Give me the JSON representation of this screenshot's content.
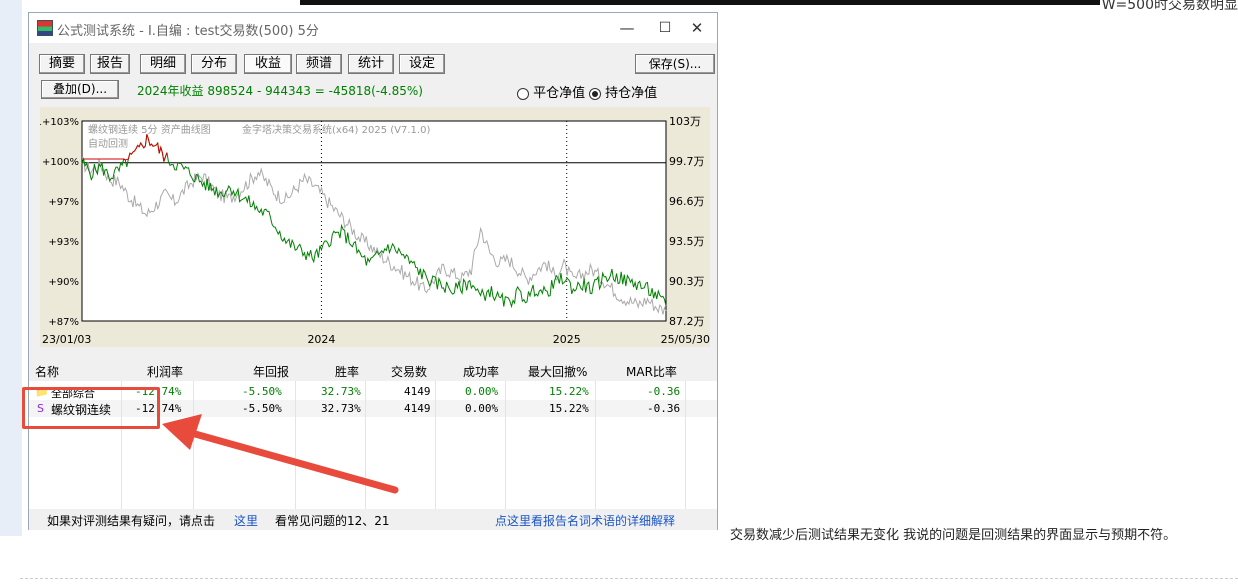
{
  "window": {
    "title": "公式测试系统 - I.自编 : test交易数(500) 5分",
    "min_symbol": "—",
    "max_symbol": "☐",
    "close_symbol": "✕"
  },
  "tabs": [
    {
      "label": "摘要"
    },
    {
      "label": "报告"
    },
    {
      "label": "明细"
    },
    {
      "label": "分布"
    },
    {
      "label": "收益"
    },
    {
      "label": "频谱"
    },
    {
      "label": "统计"
    },
    {
      "label": "设定"
    }
  ],
  "toolbar": {
    "save_label": "保存(S)...",
    "overlay_label": "叠加(D)...",
    "yearly_income": "2024年收益  898524 - 944343 = -45818(-4.85%)",
    "radio_flat": "平仓净值",
    "radio_hold": "持仓净值",
    "selected_radio": "持仓净值"
  },
  "chart_data": {
    "type": "line",
    "overlay_title_1": "螺纹钢连续 5分  资产曲线图",
    "overlay_title_2": "金字塔决策交易系统(x64) 2025 (V7.1.0)",
    "overlay_label_3": "自动回测",
    "left_ticks": [
      "1+103%",
      "+100%",
      "+97%",
      "+93%",
      "+90%",
      "+87%"
    ],
    "right_ticks": [
      "103万",
      "99.7万",
      "96.6万",
      "93.5万",
      "90.3万",
      "87.2万"
    ],
    "x_ticks": [
      "23/01/03",
      "2024",
      "2025",
      "25/05/30"
    ],
    "ylim": [
      87.2,
      103
    ],
    "baseline": 99.7,
    "series": [
      {
        "color": "#008000",
        "values": [
          99.7,
          98.9,
          99.4,
          98.6,
          99.1,
          99.9,
          100.6,
          101.6,
          101.0,
          100.1,
          99.6,
          99.2,
          98.7,
          98.1,
          97.7,
          97.3,
          97.8,
          97.1,
          96.6,
          96.0,
          95.6,
          94.6,
          93.5,
          93.0,
          92.6,
          92.2,
          92.9,
          93.9,
          94.2,
          93.5,
          92.4,
          91.7,
          92.4,
          93.1,
          92.8,
          92.1,
          91.4,
          90.7,
          90.2,
          90.0,
          89.6,
          89.9,
          90.3,
          89.1,
          89.6,
          88.9,
          88.6,
          89.4,
          89.0,
          89.8,
          89.3,
          90.2,
          90.6,
          89.7,
          90.1,
          89.7,
          90.4,
          90.9,
          90.6,
          90.3,
          90.1,
          89.7,
          89.2,
          88.4
        ]
      },
      {
        "color": "#aaaaaa",
        "values": [
          99.7,
          99.1,
          99.6,
          98.4,
          98.2,
          97.1,
          96.3,
          95.6,
          96.4,
          97.2,
          96.6,
          97.5,
          98.3,
          98.7,
          97.8,
          97.1,
          96.9,
          97.5,
          98.2,
          99.0,
          98.1,
          97.2,
          96.8,
          97.6,
          98.4,
          97.9,
          97.1,
          96.2,
          95.4,
          94.6,
          93.7,
          93.2,
          92.5,
          91.9,
          91.4,
          90.8,
          90.3,
          89.6,
          90.5,
          91.4,
          91.0,
          90.6,
          91.3,
          94.5,
          92.6,
          91.8,
          92.1,
          91.3,
          90.5,
          91.2,
          91.8,
          90.8,
          91.6,
          90.4,
          90.9,
          91.3,
          90.6,
          89.9,
          89.2,
          88.8,
          88.5,
          88.9,
          88.3,
          88.0
        ]
      }
    ]
  },
  "table": {
    "headers": [
      "名称",
      "利润率",
      "年回报",
      "胜率",
      "交易数",
      "成功率",
      "最大回撤%",
      "MAR比率"
    ],
    "rows": [
      {
        "name": "全部综合",
        "profit": "-12.74%",
        "annual": "-5.50%",
        "win": "32.73%",
        "trades": "4149",
        "success": "0.00%",
        "drawdown": "15.22%",
        "mar": "-0.36"
      },
      {
        "name": "螺纹钢连续",
        "profit": "-12.74%",
        "annual": "-5.50%",
        "win": "32.73%",
        "trades": "4149",
        "success": "0.00%",
        "drawdown": "15.22%",
        "mar": "-0.36"
      }
    ],
    "row2_icon": "S"
  },
  "status": {
    "question": "如果对评测结果有疑问，请点击",
    "here": "这里",
    "faq": "看常见问题的12、21",
    "glossary": "点这里看报告名词术语的详细解释"
  },
  "page": {
    "top_right_text": "W=500时交易数明显",
    "note": "交易数减少后测试结果无变化 我说的问题是回测结果的界面显示与预期不符。"
  },
  "colors": {
    "annotation": "#e84a3c",
    "equity": "#008000",
    "benchmark": "#aaaaaa",
    "peak": "#d40000"
  }
}
